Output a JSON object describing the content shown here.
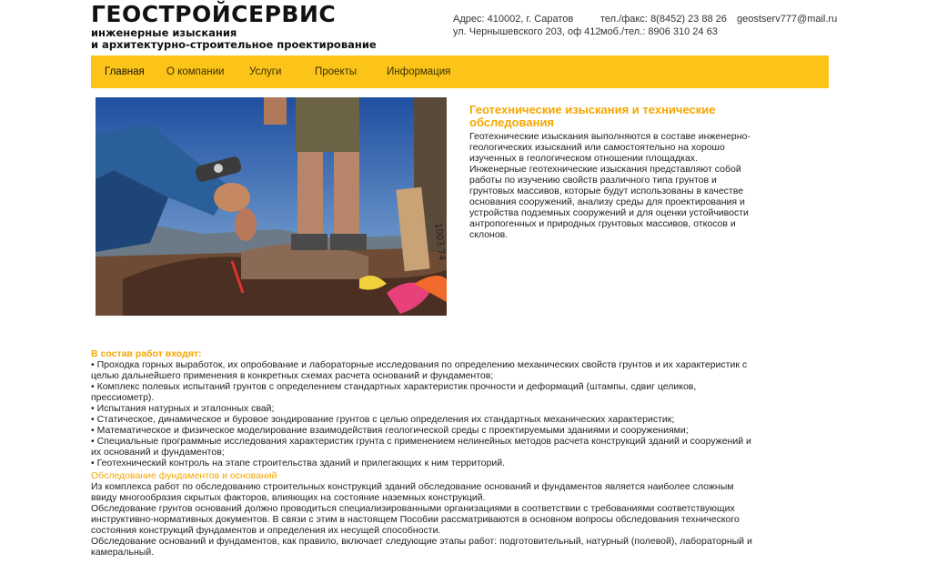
{
  "header": {
    "logo_title": "ГЕОСТРОЙСЕРВИС",
    "logo_sub_line1": "инженерные изыскания",
    "logo_sub_line2": "и архитектурно-строительное проектирование",
    "address_line1": "Адрес: 410002, г. Саратов",
    "address_line2": "ул. Чернышевского 203, оф 412",
    "phone_label": "тел./факс:",
    "phone_value": "8(8452) 23 88 26",
    "mobile_label": "моб./тел.:",
    "mobile_value": "8906 310 24 63",
    "email": "geostserv777@mail.ru"
  },
  "nav": {
    "items": [
      {
        "label": "Главная"
      },
      {
        "label": "О компании"
      },
      {
        "label": "Услуги"
      },
      {
        "label": "Проекты"
      },
      {
        "label": "Информация"
      }
    ]
  },
  "colors": {
    "accent": "#fcc419",
    "heading": "#f5a700"
  },
  "intro": {
    "title": "Геотехнические изыскания и технические обследования",
    "paragraph1": "Геотехнические изыскания выполняются в составе инженерно-геологических изысканий или самостоятельно на хорошо изученных в геологическом отношении площадках.",
    "paragraph2": "Инженерные геотехнические изыскания представляют собой работы по изучению свойств различного типа грунтов и грунтовых массивов, которые будут использованы в качестве основания сооружений, анализу среды для проектирования и устройства подземных сооружений и для оценки устойчивости антропогенных и природных грунтовых массивов, откосов и склонов."
  },
  "section1": {
    "heading": "В состав работ входят:",
    "items": [
      "• Проходка горных выработок, их опробование и лабораторные исследования по определению механических свойств грунтов и их характеристик с целью дальнейшего применения в конкретных схемах расчета оснований и фундаментов;",
      "• Комплекс полевых испытаний грунтов с определением стандартных характеристик прочности и деформаций (штампы, сдвиг целиков, прессиометр).",
      "• Испытания натурных и эталонных свай;",
      "• Статическое, динамическое и буровое зондирование грунтов с целью определения их стандартных механических характеристик;",
      "• Математическое и физическое моделирование взаимодействия геологической среды с проектируемыми зданиями и сооружениями;",
      "• Специальные программные исследования характеристик грунта с применением нелинейных методов расчета конструкций зданий и сооружений и их оснований и фундаментов;",
      "• Геотехнический контроль на этапе строительства зданий и прилегающих к ним территорий."
    ]
  },
  "section2": {
    "heading": "Обследование фундаментов и оснований",
    "paragraphs": [
      "Из комплекса работ по обследованию строительных конструкций зданий обследование оснований и фундаментов является наиболее сложным ввиду многообразия скрытых факторов, влияющих на состояние наземных конструкций.",
      "Обследование грунтов оснований должно проводиться специализированными организациями в соответствии с требованиями соответствующих инструктивно-нормативных документов. В связи с этим в настоящем Пособии рассматриваются в основном вопросы обследования технического состояния конструкций фундаментов и определения их несущей способности.",
      "Обследование оснований и фундаментов, как правило, включает следующие этапы работ: подготовительный, натурный (полевой), лабораторный и камеральный."
    ]
  },
  "photo": {
    "stake_text": "1003 74"
  }
}
